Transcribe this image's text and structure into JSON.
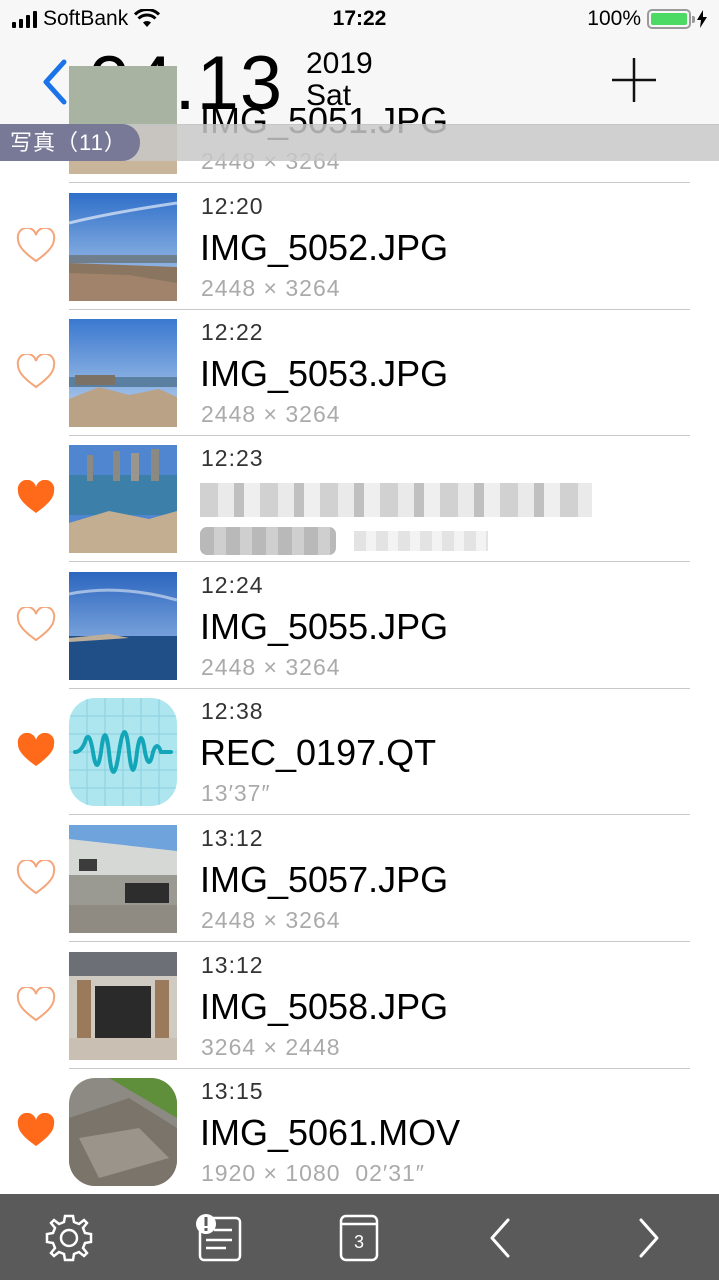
{
  "status_bar": {
    "carrier": "SoftBank",
    "time": "17:22",
    "battery_percent": "100%",
    "battery_level": 1.0,
    "battery_color": "#4cd964"
  },
  "header": {
    "back_icon": "chevron-left-icon",
    "date": "04.13",
    "year": "2019",
    "weekday": "Sat",
    "add_icon": "plus-icon",
    "accent_color": "#1a73e8"
  },
  "section": {
    "label": "写真（11）"
  },
  "items": [
    {
      "time": "",
      "name": "IMG_5051.JPG",
      "meta": "2448 × 3264",
      "favorite": false
    },
    {
      "time": "12:20",
      "name": "IMG_5052.JPG",
      "meta": "2448 × 3264",
      "favorite": false
    },
    {
      "time": "12:22",
      "name": "IMG_5053.JPG",
      "meta": "2448 × 3264",
      "favorite": false
    },
    {
      "time": "12:23",
      "name": "",
      "meta": "",
      "favorite": true,
      "redacted": true
    },
    {
      "time": "12:24",
      "name": "IMG_5055.JPG",
      "meta": "2448 × 3264",
      "favorite": false
    },
    {
      "time": "12:38",
      "name": "REC_0197.QT",
      "meta": "13′37″",
      "favorite": true
    },
    {
      "time": "13:12",
      "name": "IMG_5057.JPG",
      "meta": "2448 × 3264",
      "favorite": false
    },
    {
      "time": "13:12",
      "name": "IMG_5058.JPG",
      "meta": "3264 × 2448",
      "favorite": false
    },
    {
      "time": "13:15",
      "name": "IMG_5061.MOV",
      "meta": "1920 × 1080  02′31″",
      "favorite": true
    }
  ],
  "colors": {
    "heart": "#ff6a1a",
    "tabbar": "#5a5a5a"
  },
  "tab_bar": {
    "items": [
      {
        "icon": "gear-icon"
      },
      {
        "icon": "note-alert-icon"
      },
      {
        "icon": "calendar-icon",
        "badge": "3"
      },
      {
        "icon": "chevron-left-icon"
      },
      {
        "icon": "chevron-right-icon"
      }
    ]
  }
}
